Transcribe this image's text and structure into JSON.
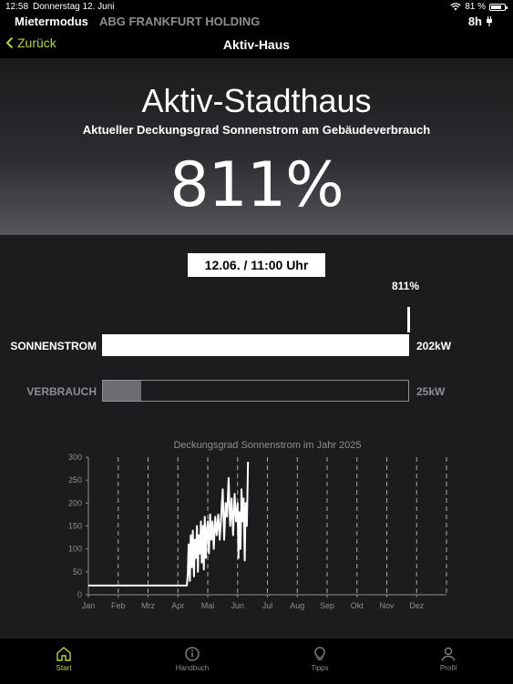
{
  "status_bar": {
    "time": "12:58",
    "date": "Donnerstag 12. Juni",
    "battery": "81 %"
  },
  "app_bar": {
    "mode": "Mietermodus",
    "holding": "ABG FRANKFURT HOLDING",
    "hours": "8h"
  },
  "nav": {
    "back_label": "Zurück",
    "title": "Aktiv-Haus"
  },
  "hero": {
    "title": "Aktiv-Stadthaus",
    "subtitle": "Aktueller Deckungsgrad Sonnenstrom am Gebäudeverbrauch",
    "value": "811%"
  },
  "snapshot": {
    "timestamp": "12.06. / 11:00 Uhr",
    "percent_label": "811%",
    "bars": [
      {
        "label": "SONNENSTROM",
        "value": "202kW",
        "fill": 1.0
      },
      {
        "label": "VERBRAUCH",
        "value": "25kW",
        "fill": 0.124
      }
    ]
  },
  "colors": {
    "accent": "#b8d234",
    "verbrauch_fill": "#6d6d72",
    "background": "#1c1c1e"
  },
  "chart_data": {
    "type": "line",
    "title": "Deckungsgrad Sonnenstrom im Jahr 2025",
    "x_ticks": [
      "Jan",
      "Feb",
      "Mrz",
      "Apr",
      "Mai",
      "Jun",
      "Jul",
      "Aug",
      "Sep",
      "Okt",
      "Nov",
      "Dez"
    ],
    "y_ticks": [
      "0",
      "50",
      "100",
      "150",
      "200",
      "250",
      "300"
    ],
    "ylim": [
      0,
      300
    ],
    "grid": "vertical dashed",
    "series": [
      {
        "values": [
          [
            0,
            20
          ],
          [
            1,
            20
          ],
          [
            2,
            20
          ],
          [
            3,
            20
          ],
          [
            3.3,
            20
          ],
          [
            3.33,
            45
          ],
          [
            3.36,
            110
          ],
          [
            3.4,
            30
          ],
          [
            3.43,
            130
          ],
          [
            3.47,
            60
          ],
          [
            3.5,
            140
          ],
          [
            3.54,
            40
          ],
          [
            3.57,
            120
          ],
          [
            3.6,
            80
          ],
          [
            3.64,
            150
          ],
          [
            3.67,
            50
          ],
          [
            3.7,
            130
          ],
          [
            3.74,
            90
          ],
          [
            3.77,
            160
          ],
          [
            3.8,
            70
          ],
          [
            3.84,
            150
          ],
          [
            3.87,
            55
          ],
          [
            3.9,
            170
          ],
          [
            3.94,
            80
          ],
          [
            3.97,
            140
          ],
          [
            4.0,
            160
          ],
          [
            4.04,
            90
          ],
          [
            4.08,
            175
          ],
          [
            4.12,
            120
          ],
          [
            4.16,
            160
          ],
          [
            4.2,
            100
          ],
          [
            4.25,
            170
          ],
          [
            4.3,
            130
          ],
          [
            4.35,
            175
          ],
          [
            4.4,
            120
          ],
          [
            4.45,
            170
          ],
          [
            4.5,
            230
          ],
          [
            4.55,
            120
          ],
          [
            4.6,
            200
          ],
          [
            4.65,
            170
          ],
          [
            4.7,
            255
          ],
          [
            4.75,
            150
          ],
          [
            4.8,
            210
          ],
          [
            4.85,
            130
          ],
          [
            4.9,
            220
          ],
          [
            4.95,
            160
          ],
          [
            5.0,
            200
          ],
          [
            5.03,
            80
          ],
          [
            5.06,
            180
          ],
          [
            5.1,
            100
          ],
          [
            5.13,
            230
          ],
          [
            5.17,
            160
          ],
          [
            5.2,
            210
          ],
          [
            5.24,
            75
          ],
          [
            5.27,
            200
          ],
          [
            5.31,
            150
          ],
          [
            5.35,
            290
          ]
        ]
      }
    ]
  },
  "tabs": [
    {
      "label": "Start",
      "icon": "home-icon",
      "active": true
    },
    {
      "label": "Handbuch",
      "icon": "info-icon",
      "active": false
    },
    {
      "label": "Tipps",
      "icon": "lightbulb-icon",
      "active": false
    },
    {
      "label": "Profil",
      "icon": "person-icon",
      "active": false
    }
  ]
}
